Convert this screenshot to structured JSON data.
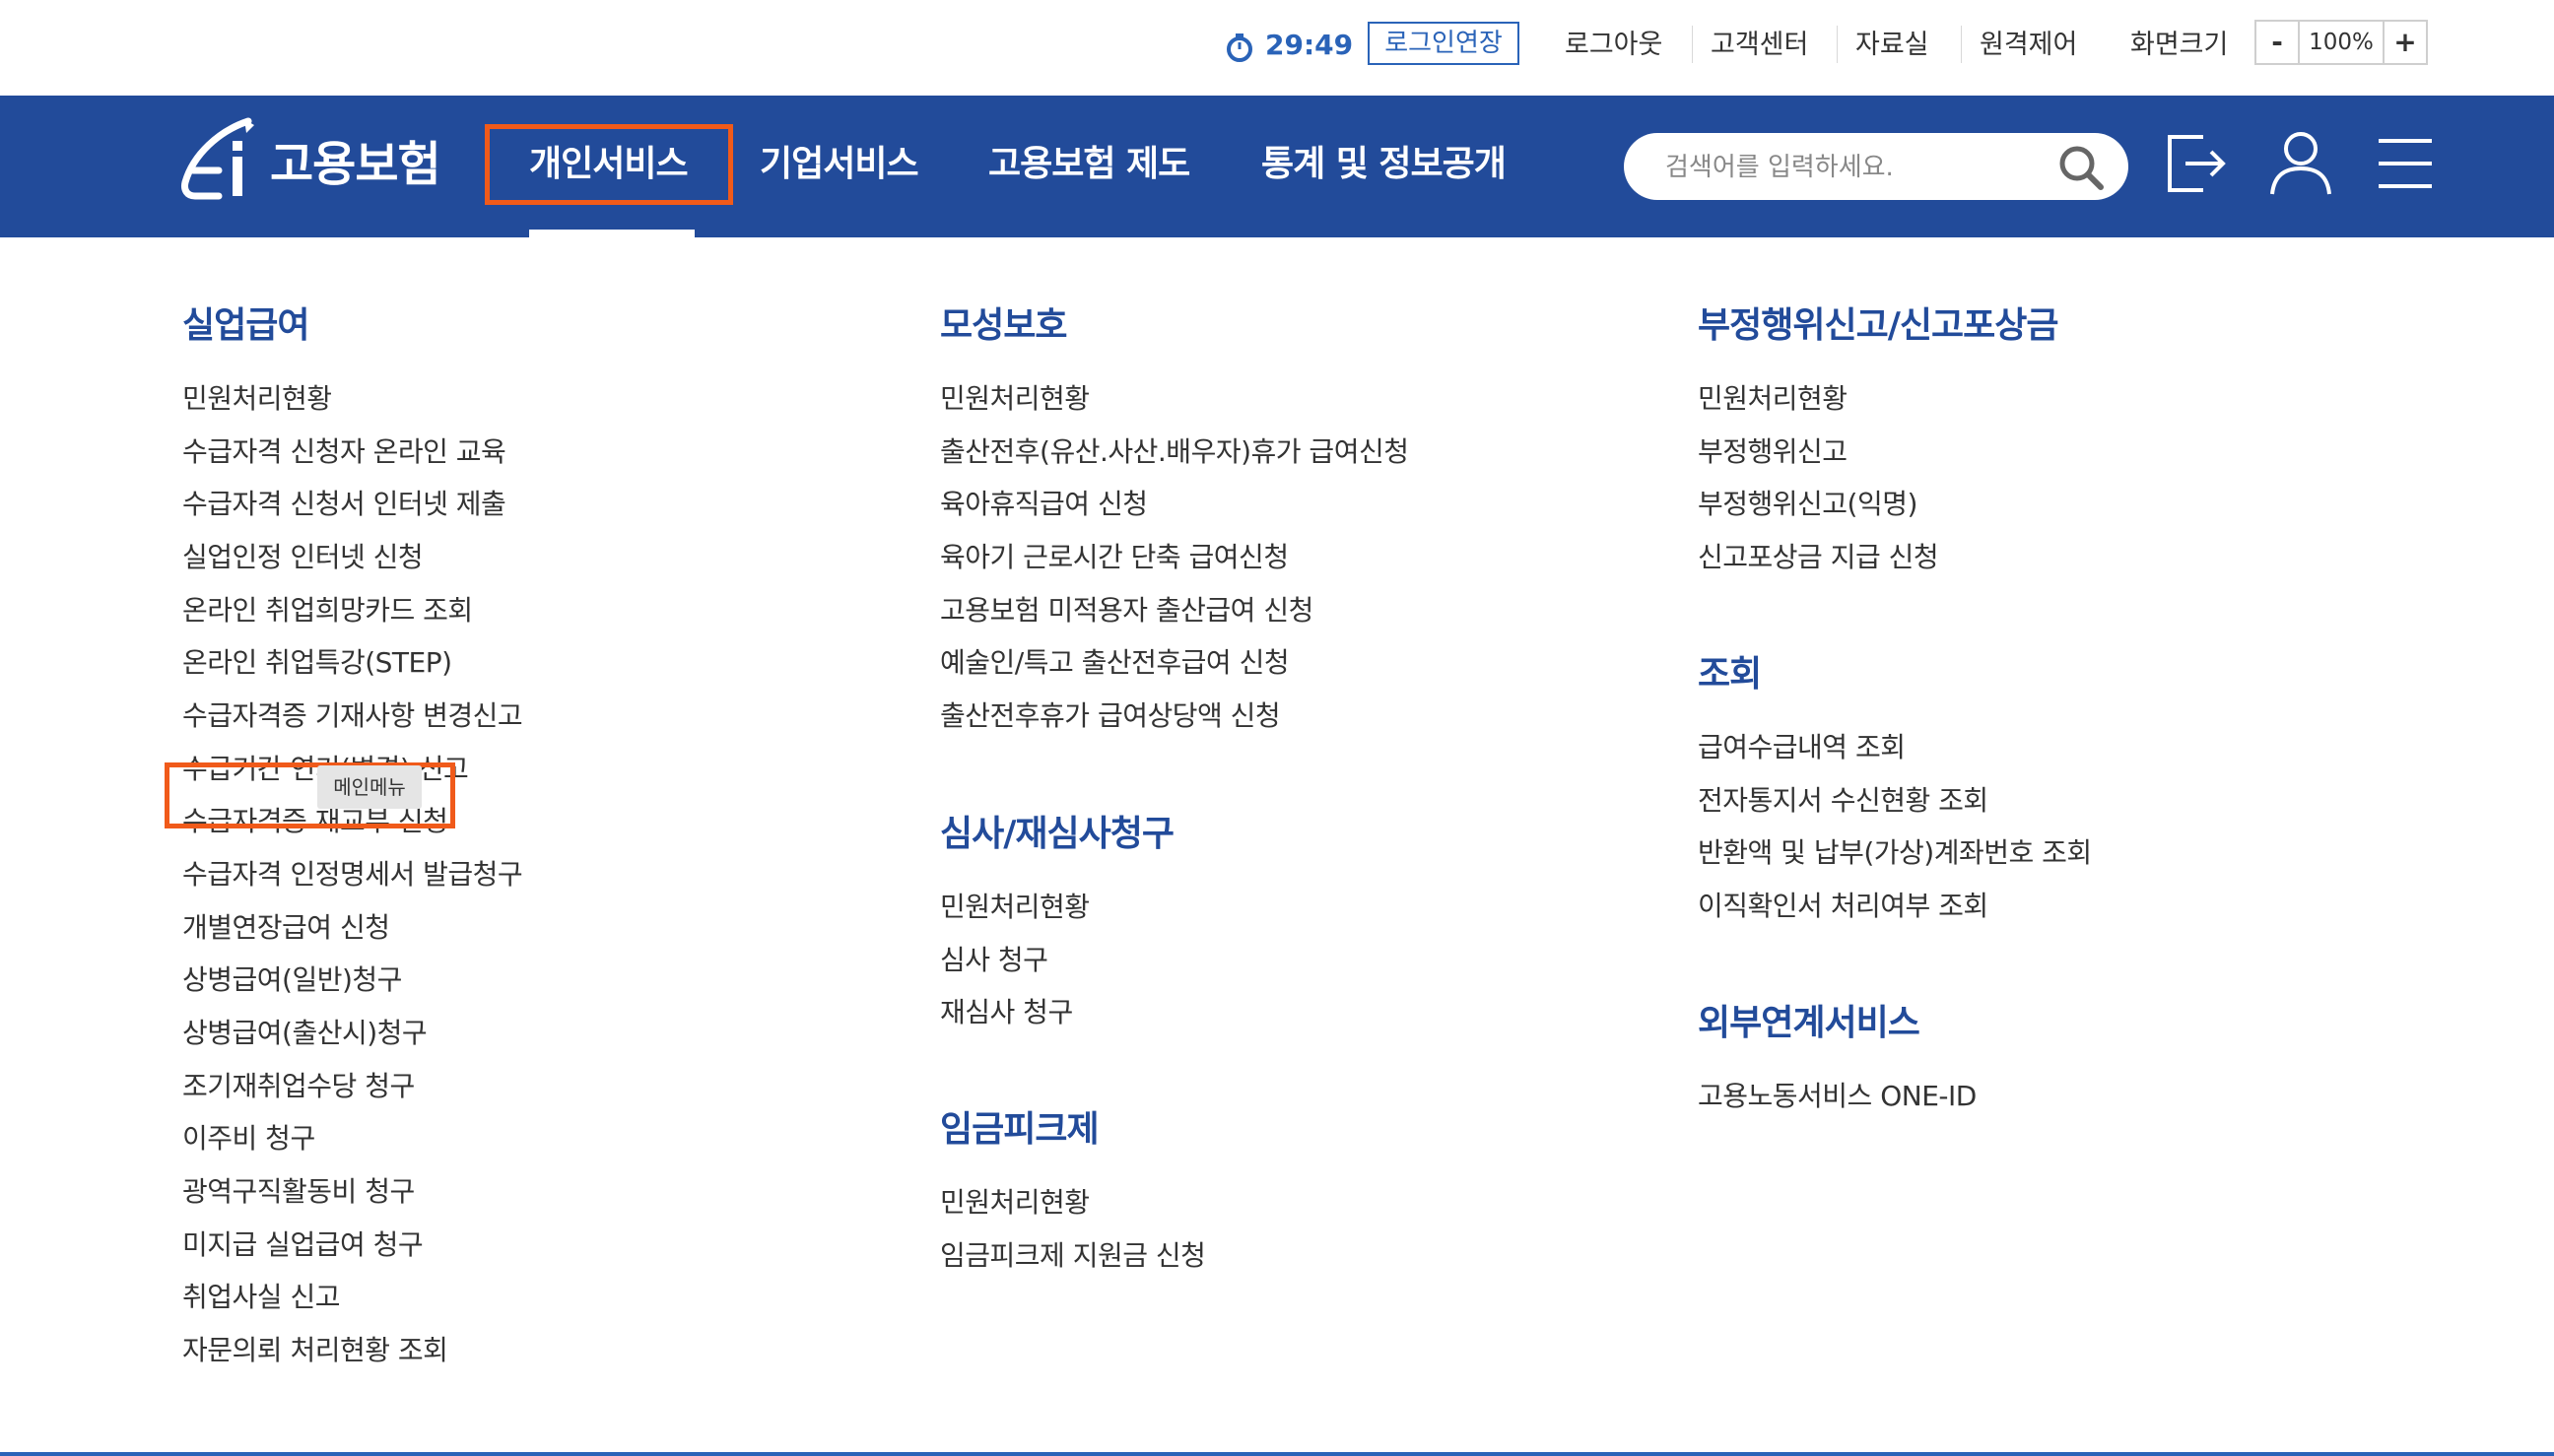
{
  "utility": {
    "timer": "29:49",
    "extend_login": "로그인연장",
    "logout": "로그아웃",
    "customer_center": "고객센터",
    "resources": "자료실",
    "remote_control": "원격제어",
    "screen_size": "화면크기",
    "zoom_minus": "-",
    "zoom_value": "100%",
    "zoom_plus": "+"
  },
  "gnb": {
    "logo_text": "고용보험",
    "nav": [
      "개인서비스",
      "기업서비스",
      "고용보험 제도",
      "통계 및 정보공개"
    ],
    "active_nav": "개인서비스",
    "search_placeholder": "검색어를 입력하세요."
  },
  "menu": {
    "col1": {
      "title": "실업급여",
      "items": [
        "민원처리현황",
        "수급자격 신청자 온라인 교육",
        "수급자격 신청서 인터넷 제출",
        "실업인정 인터넷 신청",
        "온라인 취업희망카드 조회",
        "온라인 취업특강(STEP)",
        "수급자격증 기재사항 변경신고",
        "수급기간 연기(변경) 신고",
        "수급자격증 재교부 신청",
        "수급자격 인정명세서 발급청구",
        "개별연장급여 신청",
        "상병급여(일반)청구",
        "상병급여(출산시)청구",
        "조기재취업수당 청구",
        "이주비 청구",
        "광역구직활동비 청구",
        "미지급 실업급여 청구",
        "취업사실 신고",
        "자문의뢰 처리현황 조회"
      ],
      "highlighted": "실업인정 인터넷 신청"
    },
    "col2": {
      "sections": [
        {
          "title": "모성보호",
          "items": [
            "민원처리현황",
            "출산전후(유산.사산.배우자)휴가 급여신청",
            "육아휴직급여 신청",
            "육아기 근로시간 단축 급여신청",
            "고용보험 미적용자 출산급여 신청",
            "예술인/특고 출산전후급여 신청",
            "출산전후휴가 급여상당액 신청"
          ]
        },
        {
          "title": "심사/재심사청구",
          "items": [
            "민원처리현황",
            "심사 청구",
            "재심사 청구"
          ]
        },
        {
          "title": "임금피크제",
          "items": [
            "민원처리현황",
            "임금피크제 지원금 신청"
          ]
        }
      ]
    },
    "col3": {
      "sections": [
        {
          "title": "부정행위신고/신고포상금",
          "items": [
            "민원처리현황",
            "부정행위신고",
            "부정행위신고(익명)",
            "신고포상금 지급 신청"
          ]
        },
        {
          "title": "조회",
          "items": [
            "급여수급내역 조회",
            "전자통지서 수신현황 조회",
            "반환액 및 납부(가상)계좌번호 조회",
            "이직확인서 처리여부 조회"
          ]
        },
        {
          "title": "외부연계서비스",
          "items": [
            "고용노동서비스 ONE-ID"
          ]
        }
      ]
    }
  },
  "tooltip": "메인메뉴",
  "colors": {
    "brand_blue": "#224b9a",
    "accent_blue": "#2a63b8",
    "highlight_orange": "#f05a1a"
  }
}
